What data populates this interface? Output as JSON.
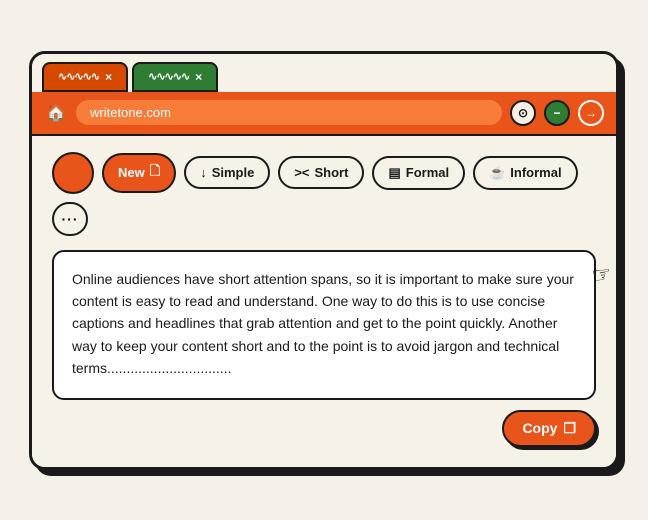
{
  "browser": {
    "tab1": {
      "squiggle": "∿∿∿∿∿",
      "close": "×",
      "active": true
    },
    "tab2": {
      "squiggle": "∿∿∿∿∿",
      "close": "×",
      "active": false
    },
    "address": "writetone.com",
    "btn_circle": "⊙",
    "btn_minus": "−",
    "btn_plus": "+"
  },
  "toolbar": {
    "new_label": "New",
    "new_icon": "🗋",
    "simple_label": "Simple",
    "simple_icon": "↓",
    "short_label": "Short",
    "short_icon": "><",
    "formal_label": "Formal",
    "formal_icon": "▤",
    "informal_label": "Informal",
    "informal_icon": "☕",
    "more_icon": "•••"
  },
  "content": {
    "text": "Online audiences have short attention spans, so it is important to make sure your content is easy to read and understand. One way to do this is to use concise captions and headlines that grab attention and get to the point quickly. Another way to keep your content short and to the point is to avoid jargon and technical terms................................"
  },
  "actions": {
    "copy_label": "Copy",
    "copy_icon": "❐"
  }
}
